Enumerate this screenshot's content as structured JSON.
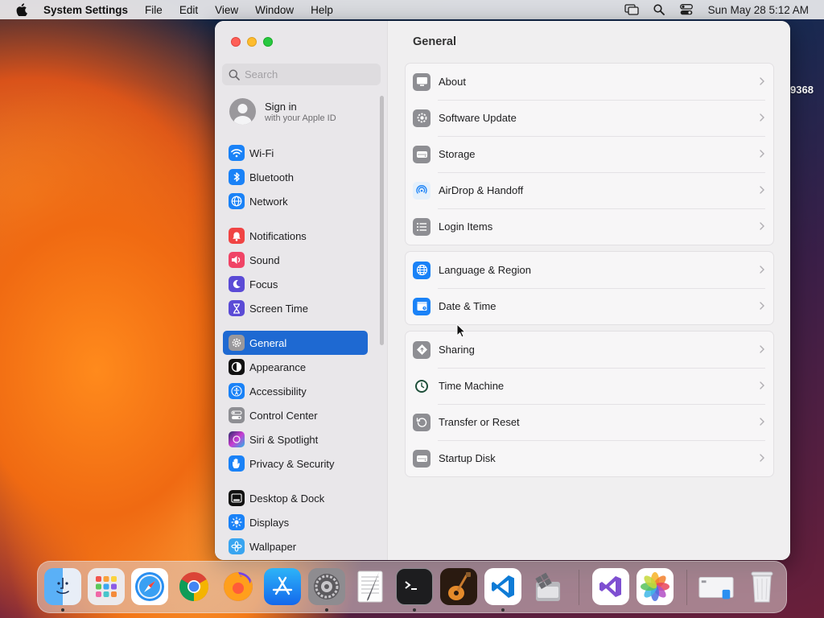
{
  "menubar": {
    "app_name": "System Settings",
    "menus": [
      "File",
      "Edit",
      "View",
      "Window",
      "Help"
    ],
    "clock": "Sun May 28  5:12 AM"
  },
  "desktop_label": "9368",
  "search": {
    "placeholder": "Search"
  },
  "account": {
    "title": "Sign in",
    "subtitle": "with your Apple ID"
  },
  "sidebar": {
    "items": [
      {
        "label": "Wi-Fi",
        "icon": "wifi-icon",
        "color": "#1a82f7"
      },
      {
        "label": "Bluetooth",
        "icon": "bluetooth-icon",
        "color": "#1a82f7"
      },
      {
        "label": "Network",
        "icon": "network-globe-icon",
        "color": "#1a82f7"
      },
      {
        "label": "Notifications",
        "icon": "notifications-bell-icon",
        "color": "#f04444"
      },
      {
        "label": "Sound",
        "icon": "sound-speaker-icon",
        "color": "#f04466"
      },
      {
        "label": "Focus",
        "icon": "focus-moon-icon",
        "color": "#5b4bd6"
      },
      {
        "label": "Screen Time",
        "icon": "screen-time-hourglass-icon",
        "color": "#5b4bd6"
      },
      {
        "label": "General",
        "icon": "general-gear-icon",
        "color": "#8e8e93",
        "selected": true
      },
      {
        "label": "Appearance",
        "icon": "appearance-icon",
        "color": "#111111"
      },
      {
        "label": "Accessibility",
        "icon": "accessibility-icon",
        "color": "#1a82f7"
      },
      {
        "label": "Control Center",
        "icon": "control-center-icon",
        "color": "#8e8e93"
      },
      {
        "label": "Siri & Spotlight",
        "icon": "siri-icon",
        "color": "#7a3fd6"
      },
      {
        "label": "Privacy & Security",
        "icon": "privacy-hand-icon",
        "color": "#1a82f7"
      },
      {
        "label": "Desktop & Dock",
        "icon": "desktop-dock-icon",
        "color": "#111111"
      },
      {
        "label": "Displays",
        "icon": "displays-sun-icon",
        "color": "#1a82f7"
      },
      {
        "label": "Wallpaper",
        "icon": "wallpaper-icon",
        "color": "#39a5f0"
      }
    ]
  },
  "main": {
    "title": "General",
    "groups": [
      [
        {
          "label": "About",
          "icon": "about-computer-icon"
        },
        {
          "label": "Software Update",
          "icon": "software-update-gear-icon"
        },
        {
          "label": "Storage",
          "icon": "storage-drive-icon"
        },
        {
          "label": "AirDrop & Handoff",
          "icon": "airdrop-icon"
        },
        {
          "label": "Login Items",
          "icon": "login-items-list-icon"
        }
      ],
      [
        {
          "label": "Language & Region",
          "icon": "language-globe-icon"
        },
        {
          "label": "Date & Time",
          "icon": "date-time-calendar-icon"
        }
      ],
      [
        {
          "label": "Sharing",
          "icon": "sharing-icon"
        },
        {
          "label": "Time Machine",
          "icon": "time-machine-icon"
        },
        {
          "label": "Transfer or Reset",
          "icon": "transfer-reset-icon"
        },
        {
          "label": "Startup Disk",
          "icon": "startup-disk-icon"
        }
      ]
    ]
  },
  "dock": {
    "apps": [
      {
        "name": "Finder",
        "icon": "finder-icon",
        "running": true
      },
      {
        "name": "Launchpad",
        "icon": "launchpad-icon"
      },
      {
        "name": "Safari",
        "icon": "safari-icon"
      },
      {
        "name": "Google Chrome",
        "icon": "chrome-icon"
      },
      {
        "name": "Firefox",
        "icon": "firefox-icon"
      },
      {
        "name": "App Store",
        "icon": "app-store-icon"
      },
      {
        "name": "System Settings",
        "icon": "system-settings-icon",
        "running": true
      },
      {
        "name": "TextEdit",
        "icon": "textedit-icon"
      },
      {
        "name": "Terminal",
        "icon": "terminal-icon",
        "running": true
      },
      {
        "name": "GarageBand",
        "icon": "garageband-icon"
      },
      {
        "name": "Visual Studio Code",
        "icon": "vscode-icon",
        "running": true
      },
      {
        "name": "Boot Camp Assistant",
        "icon": "bootcamp-icon"
      },
      {
        "name": "Visual Studio",
        "icon": "visual-studio-icon"
      },
      {
        "name": "Photos",
        "icon": "photos-icon"
      },
      {
        "name": "Screenshot Preview",
        "icon": "preview-window-icon"
      },
      {
        "name": "Trash",
        "icon": "trash-icon"
      }
    ]
  }
}
